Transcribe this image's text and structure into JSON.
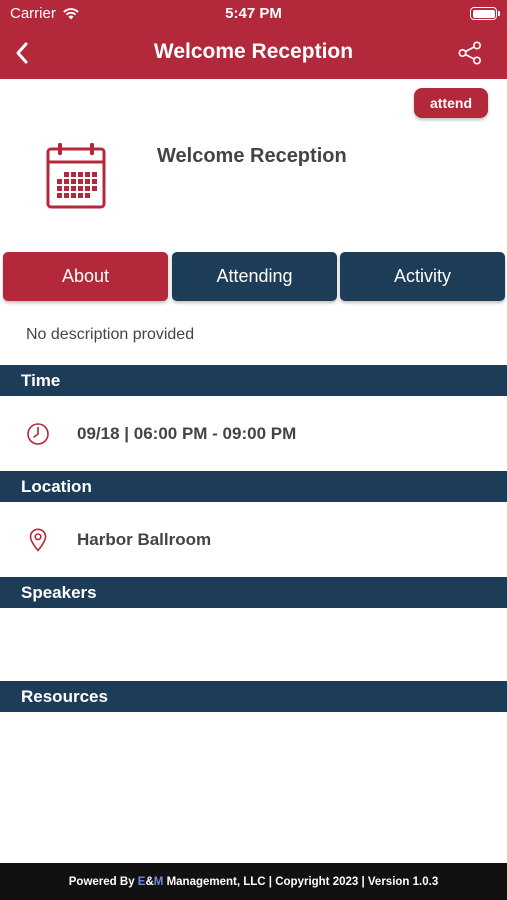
{
  "status_bar": {
    "carrier": "Carrier",
    "time": "5:47 PM"
  },
  "nav": {
    "title": "Welcome Reception",
    "back_icon": "chevron-left-icon",
    "share_icon": "share-icon"
  },
  "event": {
    "attend_label": "attend",
    "icon": "calendar-icon",
    "title": "Welcome Reception"
  },
  "tabs": [
    {
      "label": "About",
      "active": true
    },
    {
      "label": "Attending",
      "active": false
    },
    {
      "label": "Activity",
      "active": false
    }
  ],
  "description": "No description provided",
  "sections": {
    "time": {
      "header": "Time",
      "icon": "clock-icon",
      "value": "09/18 | 06:00 PM - 09:00 PM"
    },
    "location": {
      "header": "Location",
      "icon": "map-pin-icon",
      "value": "Harbor Ballroom"
    },
    "speakers": {
      "header": "Speakers"
    },
    "resources": {
      "header": "Resources"
    }
  },
  "footer": {
    "prefix": "Powered By ",
    "brand_e": "E",
    "brand_amp": "&",
    "brand_m": "M",
    "suffix": " Management, LLC | Copyright 2023 | Version 1.0.3"
  },
  "colors": {
    "primary_red": "#b3283a",
    "navy": "#1c3c57",
    "footer_bg": "#111111"
  }
}
